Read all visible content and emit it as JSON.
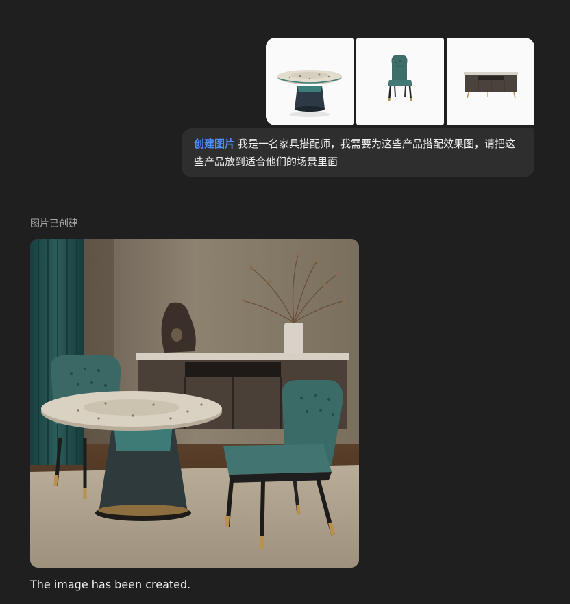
{
  "attachments": [
    {
      "icon": "round-table-thumbnail"
    },
    {
      "icon": "dining-chair-thumbnail"
    },
    {
      "icon": "sideboard-thumbnail"
    }
  ],
  "prompt": {
    "tag": "创建图片",
    "text": "我是一名家具搭配师，我需要为这些产品搭配效果图，请把这些产品放到适合他们的场景里面"
  },
  "response": {
    "status": "图片已创建",
    "image_icon": "generated-dining-room-image",
    "caption": "The image has been created."
  },
  "colors": {
    "background": "#1f1f1f",
    "bubble": "#2e2e2e",
    "accent": "#4d8fff"
  }
}
